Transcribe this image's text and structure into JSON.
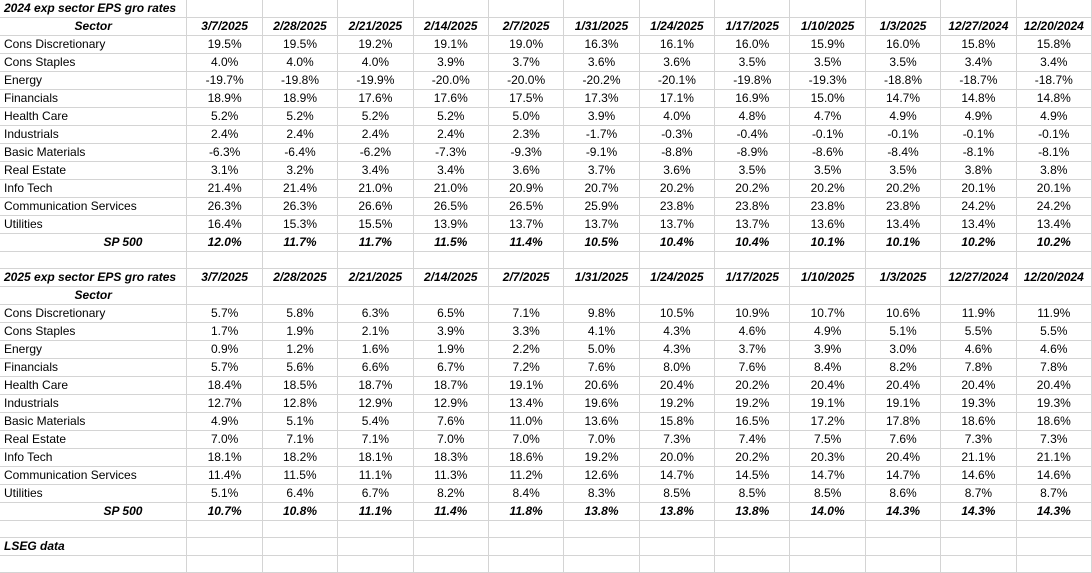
{
  "table1": {
    "title": "2024 exp sector EPS gro rates",
    "sector_header": "Sector",
    "dates": [
      "3/7/2025",
      "2/28/2025",
      "2/21/2025",
      "2/14/2025",
      "2/7/2025",
      "1/31/2025",
      "1/24/2025",
      "1/17/2025",
      "1/10/2025",
      "1/3/2025",
      "12/27/2024",
      "12/20/2024"
    ],
    "rows": [
      {
        "sector": "Cons Discretionary",
        "values": [
          "19.5%",
          "19.5%",
          "19.2%",
          "19.1%",
          "19.0%",
          "16.3%",
          "16.1%",
          "16.0%",
          "15.9%",
          "16.0%",
          "15.8%",
          "15.8%"
        ]
      },
      {
        "sector": "Cons Staples",
        "values": [
          "4.0%",
          "4.0%",
          "4.0%",
          "3.9%",
          "3.7%",
          "3.6%",
          "3.6%",
          "3.5%",
          "3.5%",
          "3.5%",
          "3.4%",
          "3.4%"
        ]
      },
      {
        "sector": "Energy",
        "values": [
          "-19.7%",
          "-19.8%",
          "-19.9%",
          "-20.0%",
          "-20.0%",
          "-20.2%",
          "-20.1%",
          "-19.8%",
          "-19.3%",
          "-18.8%",
          "-18.7%",
          "-18.7%"
        ]
      },
      {
        "sector": "Financials",
        "values": [
          "18.9%",
          "18.9%",
          "17.6%",
          "17.6%",
          "17.5%",
          "17.3%",
          "17.1%",
          "16.9%",
          "15.0%",
          "14.7%",
          "14.8%",
          "14.8%"
        ]
      },
      {
        "sector": "Health Care",
        "values": [
          "5.2%",
          "5.2%",
          "5.2%",
          "5.2%",
          "5.0%",
          "3.9%",
          "4.0%",
          "4.8%",
          "4.7%",
          "4.9%",
          "4.9%",
          "4.9%"
        ]
      },
      {
        "sector": "Industrials",
        "values": [
          "2.4%",
          "2.4%",
          "2.4%",
          "2.4%",
          "2.3%",
          "-1.7%",
          "-0.3%",
          "-0.4%",
          "-0.1%",
          "-0.1%",
          "-0.1%",
          "-0.1%"
        ]
      },
      {
        "sector": "Basic Materials",
        "values": [
          "-6.3%",
          "-6.4%",
          "-6.2%",
          "-7.3%",
          "-9.3%",
          "-9.1%",
          "-8.8%",
          "-8.9%",
          "-8.6%",
          "-8.4%",
          "-8.1%",
          "-8.1%"
        ]
      },
      {
        "sector": "Real Estate",
        "values": [
          "3.1%",
          "3.2%",
          "3.4%",
          "3.4%",
          "3.6%",
          "3.7%",
          "3.6%",
          "3.5%",
          "3.5%",
          "3.5%",
          "3.8%",
          "3.8%"
        ]
      },
      {
        "sector": "Info Tech",
        "values": [
          "21.4%",
          "21.4%",
          "21.0%",
          "21.0%",
          "20.9%",
          "20.7%",
          "20.2%",
          "20.2%",
          "20.2%",
          "20.2%",
          "20.1%",
          "20.1%"
        ]
      },
      {
        "sector": "Communication Services",
        "values": [
          "26.3%",
          "26.3%",
          "26.6%",
          "26.5%",
          "26.5%",
          "25.9%",
          "23.8%",
          "23.8%",
          "23.8%",
          "23.8%",
          "24.2%",
          "24.2%"
        ]
      },
      {
        "sector": "Utilities",
        "values": [
          "16.4%",
          "15.3%",
          "15.5%",
          "13.9%",
          "13.7%",
          "13.7%",
          "13.7%",
          "13.7%",
          "13.6%",
          "13.4%",
          "13.4%",
          "13.4%"
        ]
      }
    ],
    "total": {
      "label": "SP 500",
      "values": [
        "12.0%",
        "11.7%",
        "11.7%",
        "11.5%",
        "11.4%",
        "10.5%",
        "10.4%",
        "10.4%",
        "10.1%",
        "10.1%",
        "10.2%",
        "10.2%"
      ]
    }
  },
  "table2": {
    "title": "2025 exp sector EPS gro rates",
    "sector_header": "Sector",
    "dates": [
      "3/7/2025",
      "2/28/2025",
      "2/21/2025",
      "2/14/2025",
      "2/7/2025",
      "1/31/2025",
      "1/24/2025",
      "1/17/2025",
      "1/10/2025",
      "1/3/2025",
      "12/27/2024",
      "12/20/2024"
    ],
    "rows": [
      {
        "sector": "Cons Discretionary",
        "values": [
          "5.7%",
          "5.8%",
          "6.3%",
          "6.5%",
          "7.1%",
          "9.8%",
          "10.5%",
          "10.9%",
          "10.7%",
          "10.6%",
          "11.9%",
          "11.9%"
        ]
      },
      {
        "sector": "Cons Staples",
        "values": [
          "1.7%",
          "1.9%",
          "2.1%",
          "3.9%",
          "3.3%",
          "4.1%",
          "4.3%",
          "4.6%",
          "4.9%",
          "5.1%",
          "5.5%",
          "5.5%"
        ]
      },
      {
        "sector": "Energy",
        "values": [
          "0.9%",
          "1.2%",
          "1.6%",
          "1.9%",
          "2.2%",
          "5.0%",
          "4.3%",
          "3.7%",
          "3.9%",
          "3.0%",
          "4.6%",
          "4.6%"
        ]
      },
      {
        "sector": "Financials",
        "values": [
          "5.7%",
          "5.6%",
          "6.6%",
          "6.7%",
          "7.2%",
          "7.6%",
          "8.0%",
          "7.6%",
          "8.4%",
          "8.2%",
          "7.8%",
          "7.8%"
        ]
      },
      {
        "sector": "Health Care",
        "values": [
          "18.4%",
          "18.5%",
          "18.7%",
          "18.7%",
          "19.1%",
          "20.6%",
          "20.4%",
          "20.2%",
          "20.4%",
          "20.4%",
          "20.4%",
          "20.4%"
        ]
      },
      {
        "sector": "Industrials",
        "values": [
          "12.7%",
          "12.8%",
          "12.9%",
          "12.9%",
          "13.4%",
          "19.6%",
          "19.2%",
          "19.2%",
          "19.1%",
          "19.1%",
          "19.3%",
          "19.3%"
        ]
      },
      {
        "sector": "Basic Materials",
        "values": [
          "4.9%",
          "5.1%",
          "5.4%",
          "7.6%",
          "11.0%",
          "13.6%",
          "15.8%",
          "16.5%",
          "17.2%",
          "17.8%",
          "18.6%",
          "18.6%"
        ]
      },
      {
        "sector": "Real Estate",
        "values": [
          "7.0%",
          "7.1%",
          "7.1%",
          "7.0%",
          "7.0%",
          "7.0%",
          "7.3%",
          "7.4%",
          "7.5%",
          "7.6%",
          "7.3%",
          "7.3%"
        ]
      },
      {
        "sector": "Info Tech",
        "values": [
          "18.1%",
          "18.2%",
          "18.1%",
          "18.3%",
          "18.6%",
          "19.2%",
          "20.0%",
          "20.2%",
          "20.3%",
          "20.4%",
          "21.1%",
          "21.1%"
        ]
      },
      {
        "sector": "Communication Services",
        "values": [
          "11.4%",
          "11.5%",
          "11.1%",
          "11.3%",
          "11.2%",
          "12.6%",
          "14.7%",
          "14.5%",
          "14.7%",
          "14.7%",
          "14.6%",
          "14.6%"
        ]
      },
      {
        "sector": "Utilities",
        "values": [
          "5.1%",
          "6.4%",
          "6.7%",
          "8.2%",
          "8.4%",
          "8.3%",
          "8.5%",
          "8.5%",
          "8.5%",
          "8.6%",
          "8.7%",
          "8.7%"
        ]
      }
    ],
    "total": {
      "label": "SP 500",
      "values": [
        "10.7%",
        "10.8%",
        "11.1%",
        "11.4%",
        "11.8%",
        "13.8%",
        "13.8%",
        "13.8%",
        "14.0%",
        "14.3%",
        "14.3%",
        "14.3%"
      ]
    }
  },
  "footer": {
    "source": "LSEG data"
  }
}
